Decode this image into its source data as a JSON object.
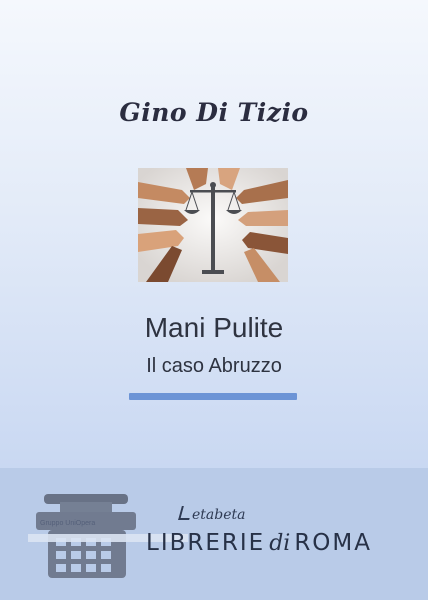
{
  "book": {
    "author": "Gino Di Tizio",
    "title": "Mani Pulite",
    "subtitle": "Il caso Abruzzo"
  },
  "colors": {
    "accent": "#6c94d6",
    "cover_top": "#f5f8fd",
    "cover_bottom": "#c9d8f2",
    "banner": "#b9cbe8"
  },
  "banner": {
    "publisher_small": "Gruppo UniOpera",
    "brand": "etabeta",
    "store_prefix": "LIBRERIE",
    "store_di": "di",
    "store_suffix": "ROMA"
  },
  "icons": {
    "illustration": "hands-scales-of-justice-image",
    "banner_icon": "typewriter-icon"
  }
}
